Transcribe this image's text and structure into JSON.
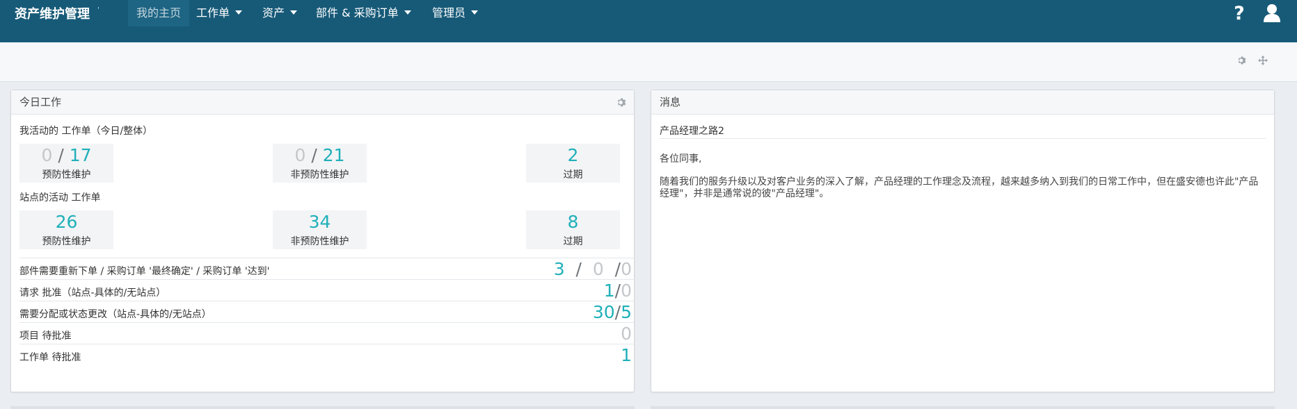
{
  "nav": {
    "brand": "资产维护管理",
    "brand_mark": "'",
    "items": [
      {
        "label": "我的主页"
      },
      {
        "label": "工作单"
      },
      {
        "label": "资产"
      },
      {
        "label": "部件 & 采购订单"
      },
      {
        "label": "管理员"
      }
    ],
    "help_icon": "question-icon",
    "user_icon": "user-icon"
  },
  "toolbar": {
    "icons": [
      "gear-icon",
      "move-icon"
    ]
  },
  "today": {
    "title": "今日工作",
    "my_label": "我活动的 工作单（今日/整体）",
    "my_stats": [
      {
        "today": "0",
        "total": "17",
        "label": "预防性维护"
      },
      {
        "today": "0",
        "total": "21",
        "label": "非预防性维护"
      },
      {
        "value": "2",
        "label": "过期"
      }
    ],
    "site_label": "站点的活动 工作单",
    "site_stats": [
      {
        "value": "26",
        "label": "预防性维护"
      },
      {
        "value": "34",
        "label": "非预防性维护"
      },
      {
        "value": "8",
        "label": "过期"
      }
    ],
    "rows": [
      {
        "label": "部件需要重新下单 / 采购订单 '最终确定' / 采购订单 '达到'",
        "v1": "3",
        "v2": "0",
        "v3": "0"
      },
      {
        "label": "请求 批准（站点-具体的/无站点）",
        "v1": "1",
        "v2": "0"
      },
      {
        "label": "需要分配或状态更改（站点-具体的/无站点）",
        "v1": "30",
        "v2": "5"
      },
      {
        "label": "项目 待批准",
        "v1": "0"
      },
      {
        "label": "工作单 待批准",
        "v1": "1"
      }
    ]
  },
  "messages": {
    "title": "消息",
    "item_title": "产品经理之路2",
    "greeting": "各位同事,",
    "body": "随着我们的服务升级以及对客户业务的深入了解，产品经理的工作理念及流程，越来越多纳入到我们的日常工作中，但在盛安德也许此\"产品经理\"，并非是通常说的彼\"产品经理\"。"
  }
}
